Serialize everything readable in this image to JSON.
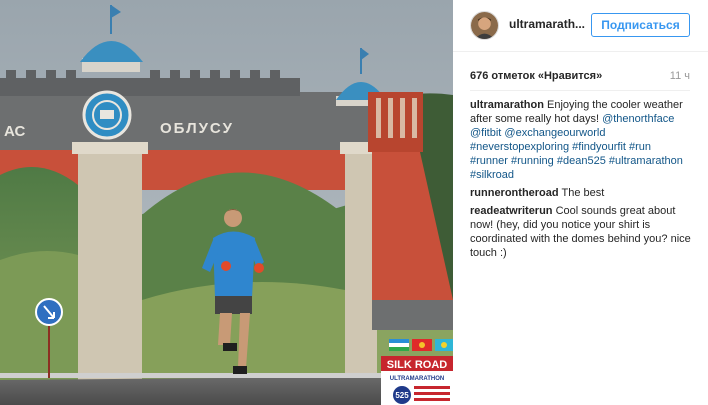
{
  "post": {
    "username": "ultramarath...",
    "follow_label": "Подписаться",
    "likes_text": "676 отметок «Нравится»",
    "time_ago": "11 ч"
  },
  "photo": {
    "arch_text_left": "АС",
    "arch_text_right": "ОБЛУСУ",
    "badge_line1": "SILK ROAD",
    "badge_line2": "ULTRAMARATHON",
    "badge_number": "525"
  },
  "comments": [
    {
      "author": "ultramarathon",
      "text": " Enjoying the cooler weather after some really hot days! ",
      "tags": [
        "@thenorthface",
        "@fitbit",
        "@exchangeourworld",
        "#neverstopexploring",
        "#findyourfit",
        "#run",
        "#runner",
        "#running",
        "#dean525",
        "#ultramarathon",
        "#silkroad"
      ]
    },
    {
      "author": "runnerontheroad",
      "text": " The best"
    },
    {
      "author": "readeatwriterun",
      "text": " Cool sounds great about now! (hey, did you notice your shirt is coordinated with the domes behind you? nice touch :)"
    }
  ],
  "colors": {
    "link": "#125688",
    "follow_blue": "#3897f0",
    "dome_blue": "#3a8fc0",
    "arch_red": "#c8503a",
    "jacket_blue": "#2f86cf"
  }
}
